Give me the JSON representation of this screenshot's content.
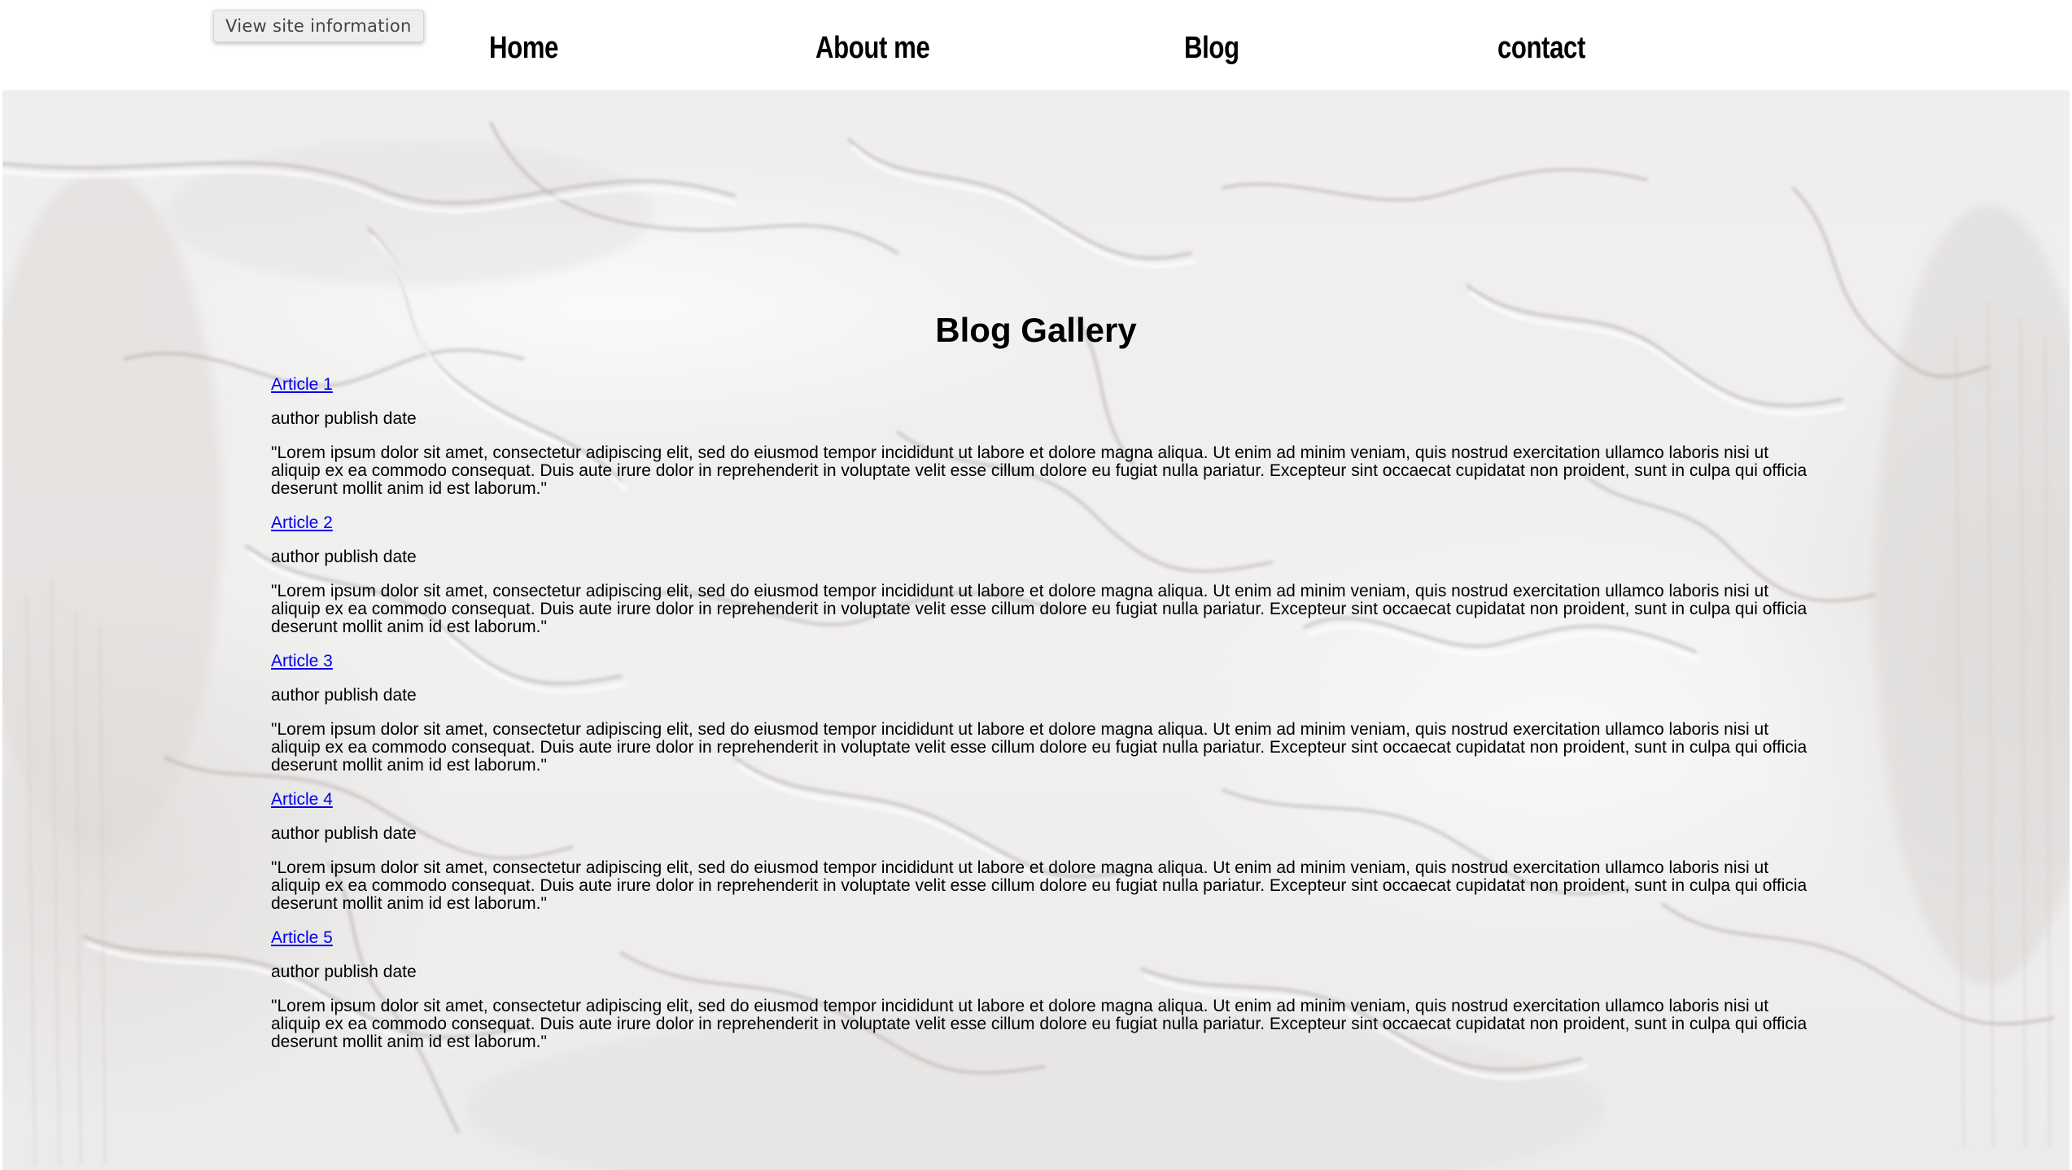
{
  "browser": {
    "tooltip": "View site information"
  },
  "nav": {
    "items": [
      {
        "label": "Home"
      },
      {
        "label": "About me"
      },
      {
        "label": "Blog"
      },
      {
        "label": "contact"
      }
    ]
  },
  "main": {
    "title": "Blog Gallery",
    "articles": [
      {
        "title": "Article 1",
        "meta": "author publish date",
        "body": "\"Lorem ipsum dolor sit amet, consectetur adipiscing elit, sed do eiusmod tempor incididunt ut labore et dolore magna aliqua. Ut enim ad minim veniam, quis nostrud exercitation ullamco laboris nisi ut aliquip ex ea commodo consequat. Duis aute irure dolor in reprehenderit in voluptate velit esse cillum dolore eu fugiat nulla pariatur. Excepteur sint occaecat cupidatat non proident, sunt in culpa qui officia deserunt mollit anim id est laborum.\""
      },
      {
        "title": "Article 2",
        "meta": "author publish date",
        "body": "\"Lorem ipsum dolor sit amet, consectetur adipiscing elit, sed do eiusmod tempor incididunt ut labore et dolore magna aliqua. Ut enim ad minim veniam, quis nostrud exercitation ullamco laboris nisi ut aliquip ex ea commodo consequat. Duis aute irure dolor in reprehenderit in voluptate velit esse cillum dolore eu fugiat nulla pariatur. Excepteur sint occaecat cupidatat non proident, sunt in culpa qui officia deserunt mollit anim id est laborum.\""
      },
      {
        "title": "Article 3",
        "meta": "author publish date",
        "body": "\"Lorem ipsum dolor sit amet, consectetur adipiscing elit, sed do eiusmod tempor incididunt ut labore et dolore magna aliqua. Ut enim ad minim veniam, quis nostrud exercitation ullamco laboris nisi ut aliquip ex ea commodo consequat. Duis aute irure dolor in reprehenderit in voluptate velit esse cillum dolore eu fugiat nulla pariatur. Excepteur sint occaecat cupidatat non proident, sunt in culpa qui officia deserunt mollit anim id est laborum.\""
      },
      {
        "title": "Article 4",
        "meta": "author publish date",
        "body": "\"Lorem ipsum dolor sit amet, consectetur adipiscing elit, sed do eiusmod tempor incididunt ut labore et dolore magna aliqua. Ut enim ad minim veniam, quis nostrud exercitation ullamco laboris nisi ut aliquip ex ea commodo consequat. Duis aute irure dolor in reprehenderit in voluptate velit esse cillum dolore eu fugiat nulla pariatur. Excepteur sint occaecat cupidatat non proident, sunt in culpa qui officia deserunt mollit anim id est laborum.\""
      },
      {
        "title": "Article 5",
        "meta": "author publish date",
        "body": "\"Lorem ipsum dolor sit amet, consectetur adipiscing elit, sed do eiusmod tempor incididunt ut labore et dolore magna aliqua. Ut enim ad minim veniam, quis nostrud exercitation ullamco laboris nisi ut aliquip ex ea commodo consequat. Duis aute irure dolor in reprehenderit in voluptate velit esse cillum dolore eu fugiat nulla pariatur. Excepteur sint occaecat cupidatat non proident, sunt in culpa qui officia deserunt mollit anim id est laborum.\""
      }
    ]
  },
  "colors": {
    "link": "#0000ee",
    "text": "#000000",
    "background": "#efeeed"
  }
}
